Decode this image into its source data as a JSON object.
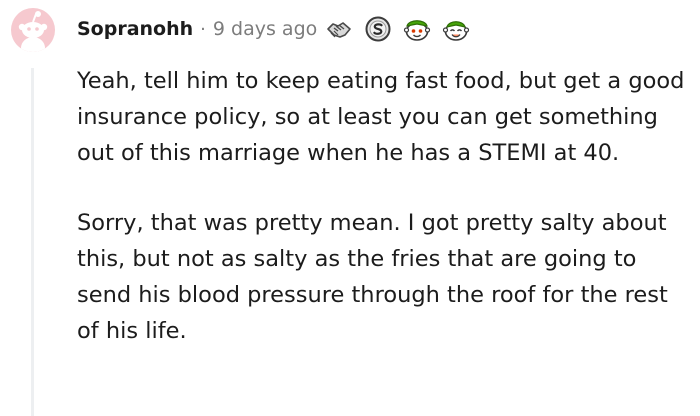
{
  "comment": {
    "username": "Sopranohh",
    "separator": "·",
    "timestamp": "9 days ago",
    "awards": [
      "handshake-award-icon",
      "silver-coin-award-icon",
      "helpful-snoo-award-icon",
      "wholesome-snoo-award-icon"
    ],
    "paragraphs": [
      "Yeah, tell him to keep eating fast food, but get a good insurance policy, so at least you can get something out of this marriage when he has a STEMI at 40.",
      "Sorry, that was pretty mean. I got pretty salty about this, but not as salty as the fries that are going to send his blood pressure through the roof for the rest of his life."
    ]
  },
  "colors": {
    "avatar_background": "#f6c9cf",
    "username": "#1c1c1c",
    "meta": "#7c7c7c",
    "thread_line": "#edeff1",
    "award_green": "#46a508"
  }
}
